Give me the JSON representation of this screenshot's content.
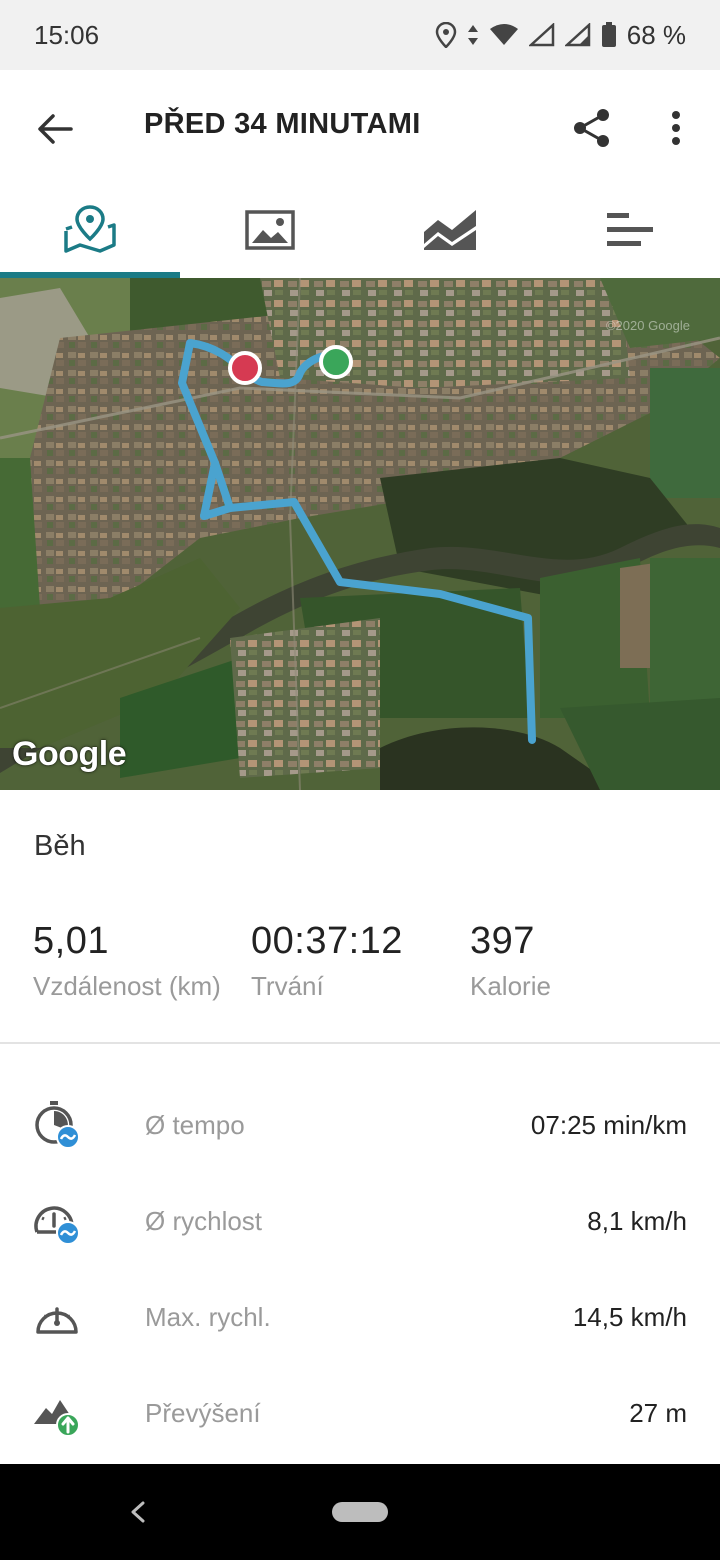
{
  "status_bar": {
    "time": "15:06",
    "battery": "68 %",
    "icons": [
      "location-icon",
      "data-arrows-icon",
      "wifi-icon",
      "signal-icon",
      "signal-icon",
      "battery-icon"
    ]
  },
  "app_bar": {
    "title": "PŘED 34 MINUTAMI",
    "icons": [
      "back-arrow-icon",
      "share-icon",
      "more-vert-icon"
    ]
  },
  "tabs": [
    {
      "name": "map",
      "icon": "map-pin-icon",
      "selected": true
    },
    {
      "name": "photos",
      "icon": "image-icon",
      "selected": false
    },
    {
      "name": "chart",
      "icon": "chart-icon",
      "selected": false
    },
    {
      "name": "details",
      "icon": "list-bars-icon",
      "selected": false
    }
  ],
  "map": {
    "logo": "Google",
    "copyright": "©2020 Google",
    "route_color": "#4aa3cf",
    "start_marker_color": "#3aa65a",
    "end_marker_color": "#d63a52"
  },
  "activity": {
    "type": "Běh",
    "summary": [
      {
        "value": "5,01",
        "label": "Vzdálenost (km)"
      },
      {
        "value": "00:37:12",
        "label": "Trvání"
      },
      {
        "value": "397",
        "label": "Kalorie"
      }
    ],
    "stats": [
      {
        "icon": "pace-icon",
        "label": "Ø tempo",
        "value": "07:25 min/km"
      },
      {
        "icon": "avg-speed-icon",
        "label": "Ø rychlost",
        "value": "8,1 km/h"
      },
      {
        "icon": "speedometer-icon",
        "label": "Max. rychl.",
        "value": "14,5 km/h"
      },
      {
        "icon": "elevation-icon",
        "label": "Převýšení",
        "value": "27 m"
      }
    ]
  },
  "colors": {
    "accent": "#1b7b86",
    "icon_blue": "#2f8fd6",
    "icon_green": "#3aa65a",
    "secondary_text": "#9a9a9a"
  },
  "nav_bar": {
    "icons": [
      "nav-back-icon",
      "home-pill-icon"
    ]
  }
}
